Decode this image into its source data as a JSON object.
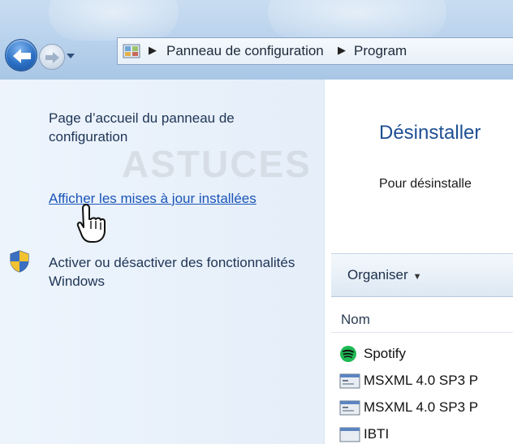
{
  "address_bar": {
    "crumbs": [
      "Panneau de configuration",
      "Program"
    ]
  },
  "left_pane": {
    "home_link": "Page d’accueil du panneau de configuration",
    "updates_link": "Afficher les mises à jour installées",
    "features_link": "Activer ou désactiver des fonctionnalités Windows"
  },
  "right_pane": {
    "title": "Désinstaller",
    "description": "Pour désinstalle",
    "toolbar": {
      "organise_label": "Organiser"
    },
    "column_header": "Nom",
    "programs": [
      {
        "name": "Spotify",
        "icon": "spotify-icon"
      },
      {
        "name": "MSXML 4.0 SP3 P",
        "icon": "program-icon"
      },
      {
        "name": "MSXML 4.0 SP3 P",
        "icon": "program-icon"
      },
      {
        "name": "IBTI",
        "icon": "program-icon"
      }
    ]
  },
  "watermark": "ASTUCES",
  "colors": {
    "link_blue": "#1a55b8",
    "title_blue": "#1e4f93",
    "left_pane_bg": "#e5eef9",
    "spotify_green": "#1db954"
  }
}
